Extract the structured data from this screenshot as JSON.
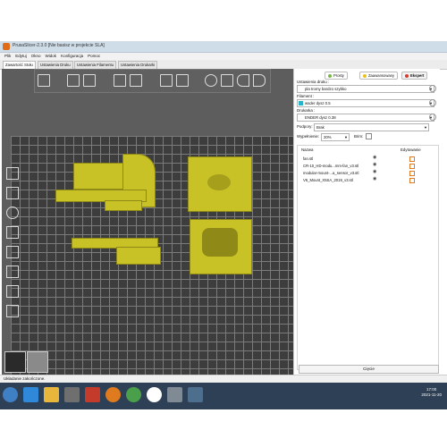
{
  "window": {
    "title": "PrusaSlicer-2.3.0 [Nie basisz w projekcie SLA]",
    "menu": [
      "Plik",
      "Edytuj",
      "Okno",
      "Widok",
      "Konfiguracja",
      "Pomoc"
    ]
  },
  "tabs": [
    {
      "label": "Zawartość Stołu",
      "active": true
    },
    {
      "label": "Ustawienia Druku",
      "active": false
    },
    {
      "label": "Ustawienia Filamentu",
      "active": false
    },
    {
      "label": "Ustawienia Drukarki",
      "active": false
    }
  ],
  "toolbar_icons": [
    "add-icon",
    "delete-icon",
    "delete-all-icon",
    "arrange-icon",
    "copy-icon",
    "paste-icon",
    "add-instance-icon",
    "remove-instance-icon",
    "split-objects-icon",
    "split-parts-icon",
    "search-icon",
    "layers-icon",
    "undo-icon",
    "redo-icon"
  ],
  "left_tools": [
    "move-icon",
    "scale-icon",
    "rotate-icon",
    "place-on-face-icon",
    "cut-icon",
    "paint-supports-icon",
    "seam-icon",
    "layer-height-icon"
  ],
  "right_panel": {
    "modes": [
      {
        "label": "Prosty",
        "color": "#7ab648"
      },
      {
        "label": "Zaawansowany",
        "color": "#e6c21b"
      },
      {
        "label": "Ekspert",
        "color": "#d63a2a",
        "active": true
      }
    ],
    "print_settings_label": "Ustawienia druku :",
    "print_settings_value": "pla tromy bardzo szybko",
    "filament_label": "Filament :",
    "filament_value": "wsder dysz 0.5",
    "filament_color": "#28b4c8",
    "printer_label": "Drukarka :",
    "printer_value": "ENDER dysz 0.38",
    "supports_label": "Podpory:",
    "supports_value": "Brak",
    "infill_label": "Wypełnienie:",
    "infill_value": "20%",
    "brim_label": "Brim:",
    "table_header_name": "Nazwa",
    "table_header_edit": "Edytowanie",
    "objects": [
      "fan.stl",
      "CR-10_HD-modu...mm-fan_v3.stl",
      "modular-mount-...a_sensor_v3.stl",
      "V6_Mount_X5SA_2019_v3.stl"
    ],
    "slice_button": "Cięcie"
  },
  "status_text": "Układanie zakończone.",
  "clock": {
    "time": "17:00",
    "date": "2021-11-20"
  },
  "colors": {
    "model": "#c9c227",
    "bed": "#3d3d3d",
    "taskbar": "#2d4055"
  }
}
